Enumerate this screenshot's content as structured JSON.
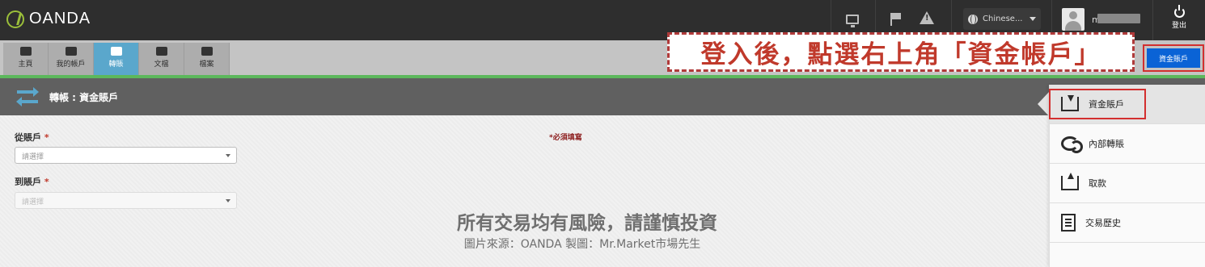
{
  "topbar": {
    "logo_text": "OANDA",
    "language": "Chinese...",
    "username": "m",
    "logout_label": "登出"
  },
  "nav": {
    "tabs": [
      {
        "label": "主頁",
        "icon": "dashboard-icon",
        "active": false
      },
      {
        "label": "我的帳戶",
        "icon": "bar-chart-icon",
        "active": false
      },
      {
        "label": "轉賬",
        "icon": "transfer-icon",
        "active": true
      },
      {
        "label": "文檔",
        "icon": "folder-icon",
        "active": false
      },
      {
        "label": "檔案",
        "icon": "profile-icon",
        "active": false
      }
    ],
    "account_button": "資金賬戶"
  },
  "annotation": {
    "text": "登入後，點選右上角「資金帳戶」"
  },
  "page": {
    "title": "轉帳 : 資金賬戶",
    "from_label": "從賬戶",
    "to_label": "到賬戶",
    "required_mark": "*",
    "from_placeholder": "請選擇",
    "to_placeholder": "請選擇",
    "required_note": "*必須填寫"
  },
  "watermark": {
    "risk": "所有交易均有風險，請謹慎投資",
    "source": "圖片來源：OANDA 製圖：Mr.Market市場先生"
  },
  "dropdown": {
    "items": [
      {
        "label": "資金賬戶",
        "icon": "deposit-icon"
      },
      {
        "label": "內部轉賬",
        "icon": "internal-transfer-icon"
      },
      {
        "label": "取款",
        "icon": "withdraw-icon"
      },
      {
        "label": "交易歷史",
        "icon": "history-icon"
      }
    ]
  },
  "colors": {
    "accent_blue": "#0a63d6",
    "active_tab": "#5aa7cc",
    "green_line": "#5cb85c",
    "annotation_red": "#c0392b"
  }
}
